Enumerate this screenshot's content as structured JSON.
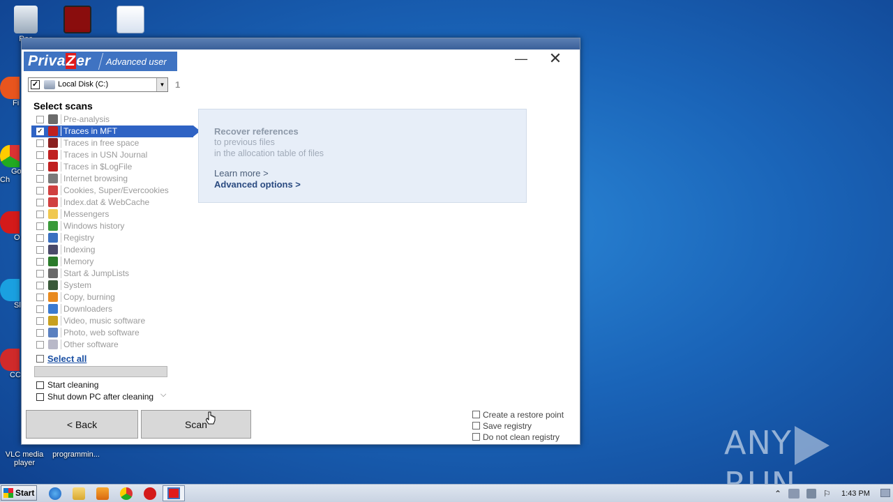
{
  "desktop": {
    "icons": [
      {
        "label": "Rec"
      },
      {
        "label": ""
      },
      {
        "label": ""
      },
      {
        "label": "VLC media player"
      },
      {
        "label": "programmin..."
      }
    ],
    "edge_labels": [
      "Fi",
      "Go Ch",
      "O",
      "Sl",
      "CC"
    ],
    "watermark": "ANY RUN"
  },
  "window": {
    "brand_name_pre": "Priva",
    "brand_name_z": "Z",
    "brand_name_post": "er",
    "brand_mode": "Advanced user",
    "minimize_label": "—",
    "close_label": "✕",
    "drive": {
      "label": "Local Disk (C:)",
      "checked": "✓",
      "count": "1",
      "arrow": "▼"
    },
    "heading": "Select scans",
    "scans": [
      {
        "label": "Pre-analysis",
        "icon": "grid-icon",
        "color": "#6b6b6b",
        "checked": ""
      },
      {
        "label": "Traces in MFT",
        "icon": "mft-icon",
        "color": "#c02020",
        "checked": "✓",
        "selected": true
      },
      {
        "label": "Traces in free space",
        "icon": "grid-icon",
        "color": "#8a2020",
        "checked": ""
      },
      {
        "label": "Traces in USN Journal",
        "icon": "usn-icon",
        "color": "#c02020",
        "checked": ""
      },
      {
        "label": "Traces in $LogFile",
        "icon": "logfile-icon",
        "color": "#c02020",
        "checked": ""
      },
      {
        "label": "Internet browsing",
        "icon": "fingerprint-icon",
        "color": "#7a7a7a",
        "checked": ""
      },
      {
        "label": "Cookies, Super/Evercookies",
        "icon": "fingerprint-icon",
        "color": "#d04040",
        "checked": ""
      },
      {
        "label": "Index.dat & WebCache",
        "icon": "fingerprint-icon",
        "color": "#d04040",
        "checked": ""
      },
      {
        "label": "Messengers",
        "icon": "chat-icon",
        "color": "#f0c850",
        "checked": ""
      },
      {
        "label": "Windows history",
        "icon": "clock-icon",
        "color": "#3a9a3a",
        "checked": ""
      },
      {
        "label": "Registry",
        "icon": "registry-icon",
        "color": "#3a70c0",
        "checked": ""
      },
      {
        "label": "Indexing",
        "icon": "list-icon",
        "color": "#4a4a6a",
        "checked": ""
      },
      {
        "label": "Memory",
        "icon": "memory-icon",
        "color": "#2a7a2a",
        "checked": ""
      },
      {
        "label": "Start & JumpLists",
        "icon": "pin-icon",
        "color": "#6a6a6a",
        "checked": ""
      },
      {
        "label": "System",
        "icon": "monitor-icon",
        "color": "#3a5a3a",
        "checked": ""
      },
      {
        "label": "Copy, burning",
        "icon": "flame-icon",
        "color": "#e88a20",
        "checked": ""
      },
      {
        "label": "Downloaders",
        "icon": "download-icon",
        "color": "#3a7ad0",
        "checked": ""
      },
      {
        "label": "Video, music software",
        "icon": "media-icon",
        "color": "#c8a020",
        "checked": ""
      },
      {
        "label": "Photo, web software",
        "icon": "photo-icon",
        "color": "#5a80c0",
        "checked": ""
      },
      {
        "label": "Other software",
        "icon": "software-icon",
        "color": "#b8b8c8",
        "checked": ""
      }
    ],
    "select_all": "Select all",
    "start_cleaning": "Start cleaning",
    "shutdown": "Shut down PC after cleaning",
    "shutdown_chevron": "⌵",
    "info": {
      "title": "Recover references",
      "line1": "to previous files",
      "line2": "in the allocation table of files",
      "learn_more": "Learn more >",
      "advanced": "Advanced options >"
    },
    "back_button": "< Back",
    "scan_button": "Scan",
    "restore_point": "Create a restore point",
    "save_registry": "Save registry",
    "no_clean_registry": "Do not clean registry"
  },
  "taskbar": {
    "start_label": "Start",
    "clock": "1:43 PM",
    "tray_up": "⌃",
    "tray_flag": "⚐"
  }
}
